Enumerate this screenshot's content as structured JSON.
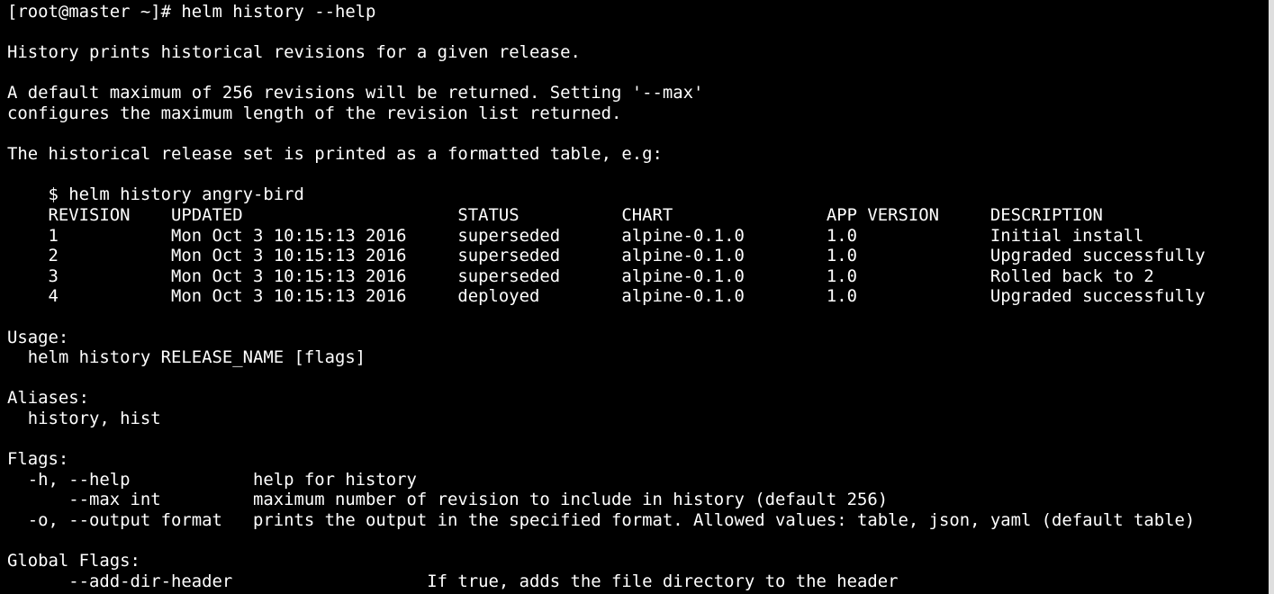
{
  "terminal": {
    "lines": [
      "[root@master ~]# helm history --help",
      "",
      "History prints historical revisions for a given release.",
      "",
      "A default maximum of 256 revisions will be returned. Setting '--max'",
      "configures the maximum length of the revision list returned.",
      "",
      "The historical release set is printed as a formatted table, e.g:",
      "",
      "    $ helm history angry-bird",
      "    REVISION    UPDATED                     STATUS          CHART               APP VERSION     DESCRIPTION",
      "    1           Mon Oct 3 10:15:13 2016     superseded      alpine-0.1.0        1.0             Initial install",
      "    2           Mon Oct 3 10:15:13 2016     superseded      alpine-0.1.0        1.0             Upgraded successfully",
      "    3           Mon Oct 3 10:15:13 2016     superseded      alpine-0.1.0        1.0             Rolled back to 2",
      "    4           Mon Oct 3 10:15:13 2016     deployed        alpine-0.1.0        1.0             Upgraded successfully",
      "",
      "Usage:",
      "  helm history RELEASE_NAME [flags]",
      "",
      "Aliases:",
      "  history, hist",
      "",
      "Flags:",
      "  -h, --help            help for history",
      "      --max int         maximum number of revision to include in history (default 256)",
      "  -o, --output format   prints the output in the specified format. Allowed values: table, json, yaml (default table)",
      "",
      "Global Flags:",
      "      --add-dir-header                   If true, adds the file directory to the header"
    ]
  }
}
